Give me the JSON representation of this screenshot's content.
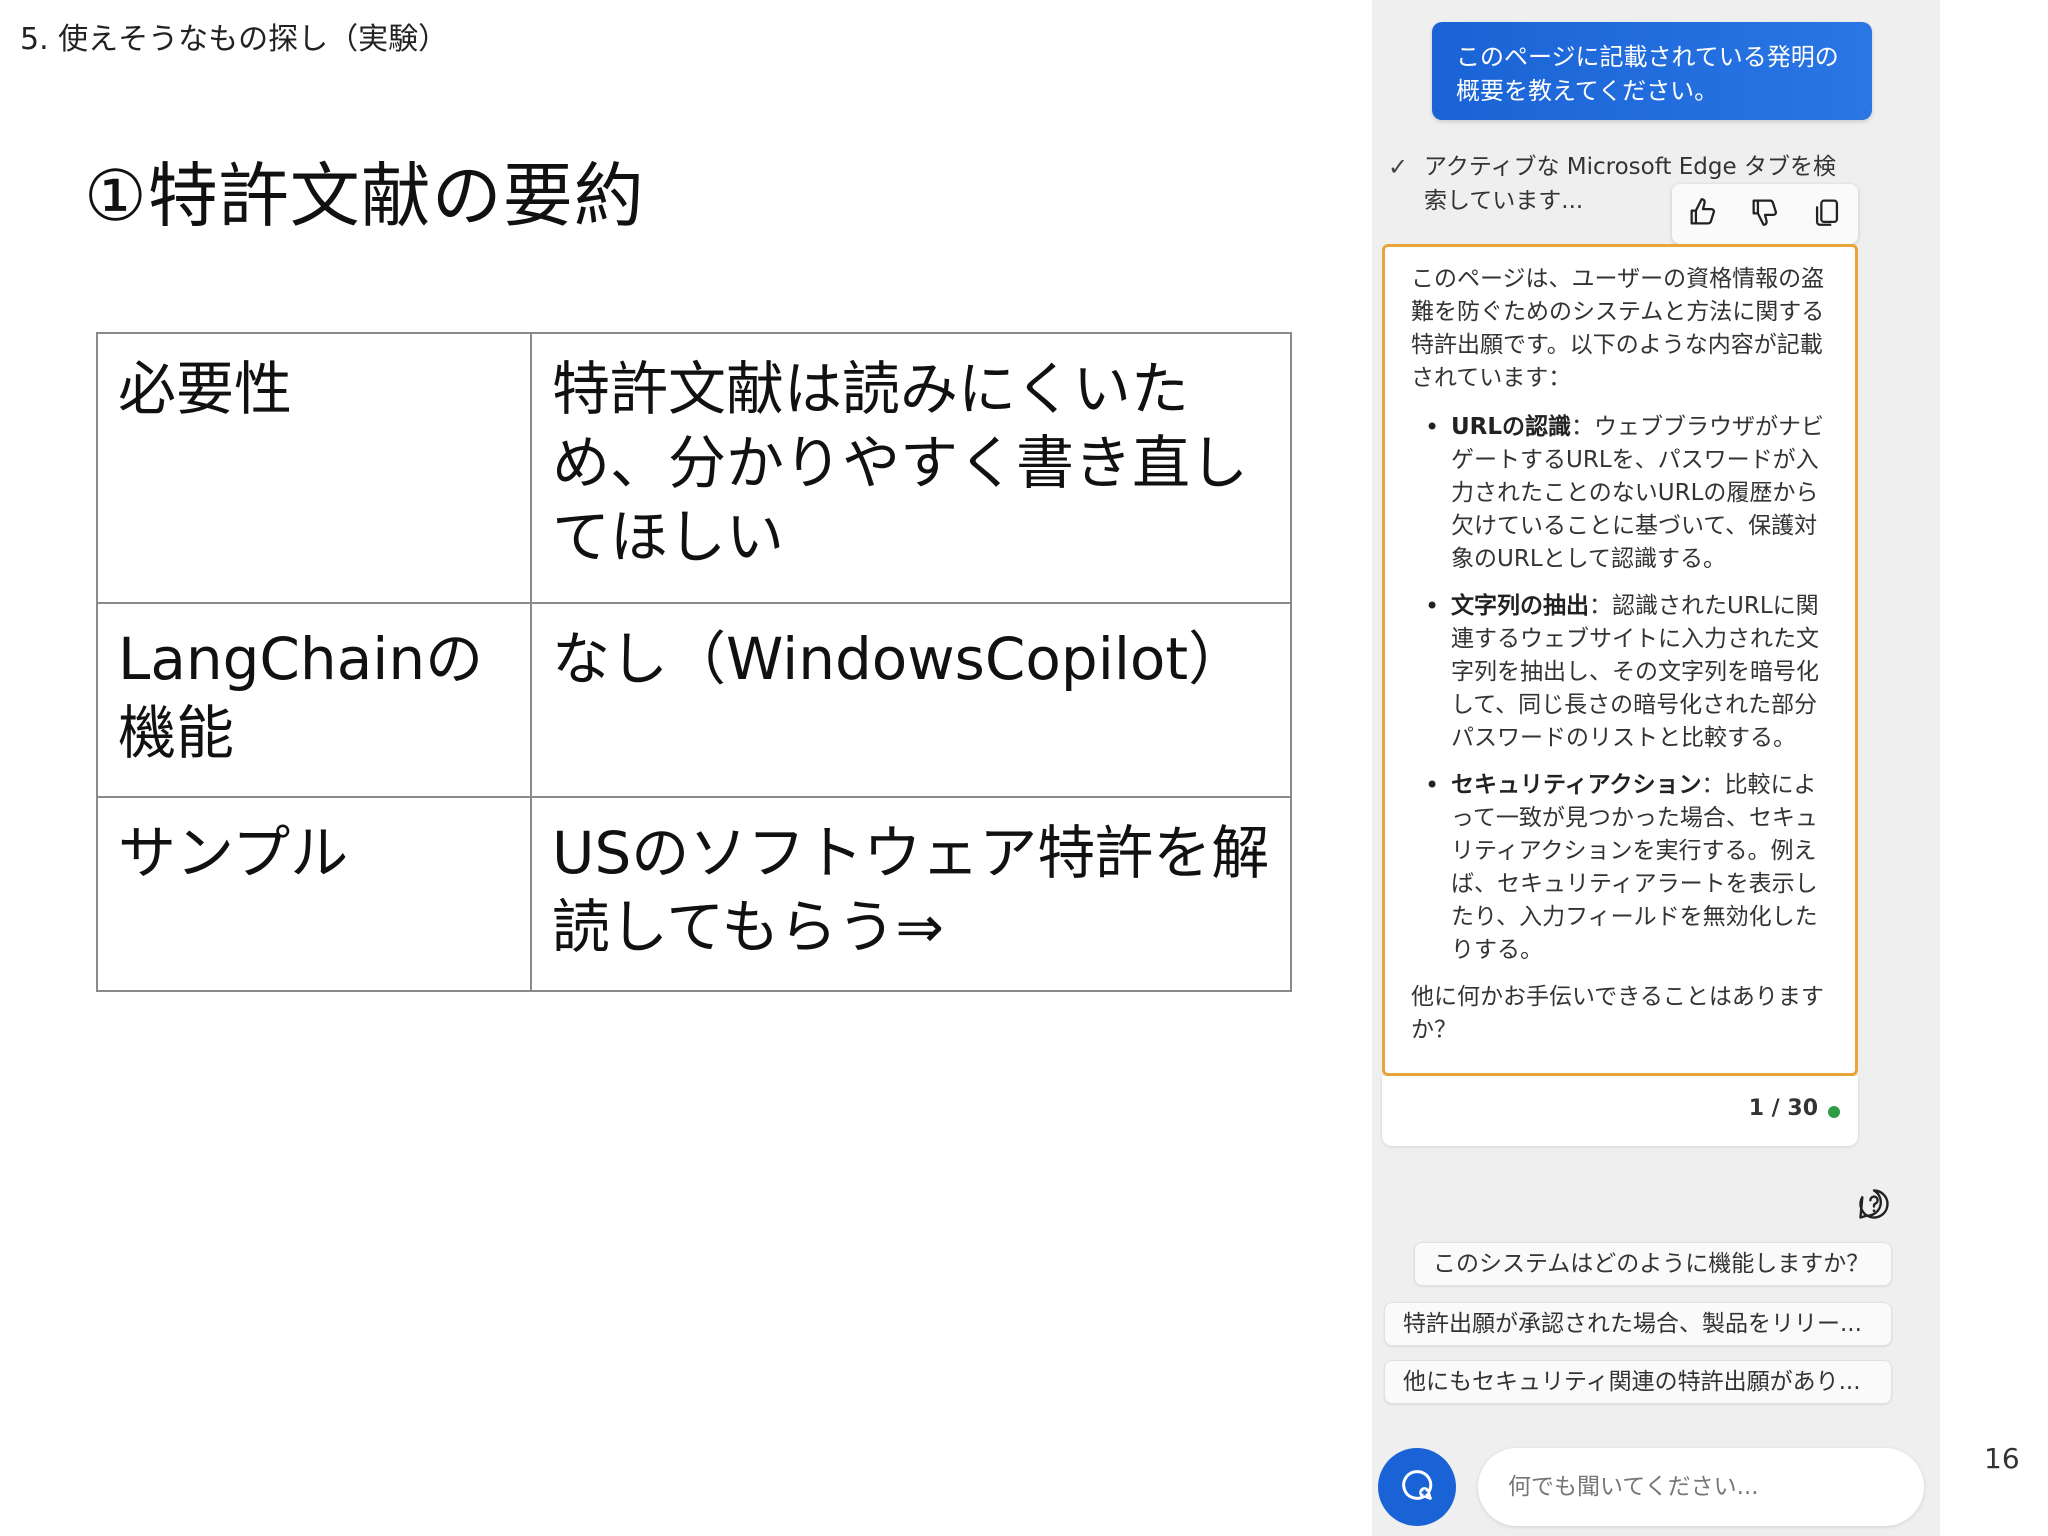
{
  "slide": {
    "section_header": "5. 使えそうなもの探し（実験）",
    "title": "①特許文献の要約",
    "table": [
      {
        "label": "必要性",
        "value": "特許文献は読みにくいため、分かりやすく書き直してほしい"
      },
      {
        "label": "LangChainの機能",
        "value": "なし（WindowsCopilot）"
      },
      {
        "label": "サンプル",
        "value": "USのソフトウェア特許を解読してもらう⇒"
      }
    ],
    "page_number": "16"
  },
  "copilot": {
    "user_message": "このページに記載されている発明の概要を教えてください。",
    "status": "アクティブな Microsoft Edge タブを検索しています...",
    "response": {
      "intro": "このページは、ユーザーの資格情報の盗難を防ぐためのシステムと方法に関する特許出願です。以下のような内容が記載されています：",
      "bullets": [
        {
          "title": "URLの認識",
          "text": "：ウェブブラウザがナビゲートするURLを、パスワードが入力されたことのないURLの履歴から欠けていることに基づいて、保護対象のURLとして認識する。"
        },
        {
          "title": "文字列の抽出",
          "text": "：認識されたURLに関連するウェブサイトに入力された文字列を抽出し、その文字列を暗号化して、同じ長さの暗号化された部分パスワードのリストと比較する。"
        },
        {
          "title": "セキュリティアクション",
          "text": "：比較によって一致が見つかった場合、セキュリティアクションを実行する。例えば、セキュリティアラートを表示したり、入力フィールドを無効化したりする。"
        }
      ],
      "closing": "他に何かお手伝いできることはありますか？"
    },
    "counter": "1 / 30",
    "status_color": "#2e9b45",
    "accent_color": "#1a63d6",
    "highlight_border_color": "#e9a53a",
    "suggestions": [
      "このシステムはどのように機能しますか？",
      "特許出願が承認された場合、製品をリリー...",
      "他にもセキュリティ関連の特許出願があり..."
    ],
    "input_placeholder": "何でも聞いてください...",
    "icons": {
      "check": "check-icon",
      "like": "thumbs-up-icon",
      "dislike": "thumbs-down-icon",
      "copy": "copy-icon",
      "help": "help-icon",
      "new_topic": "new-topic-icon"
    }
  }
}
